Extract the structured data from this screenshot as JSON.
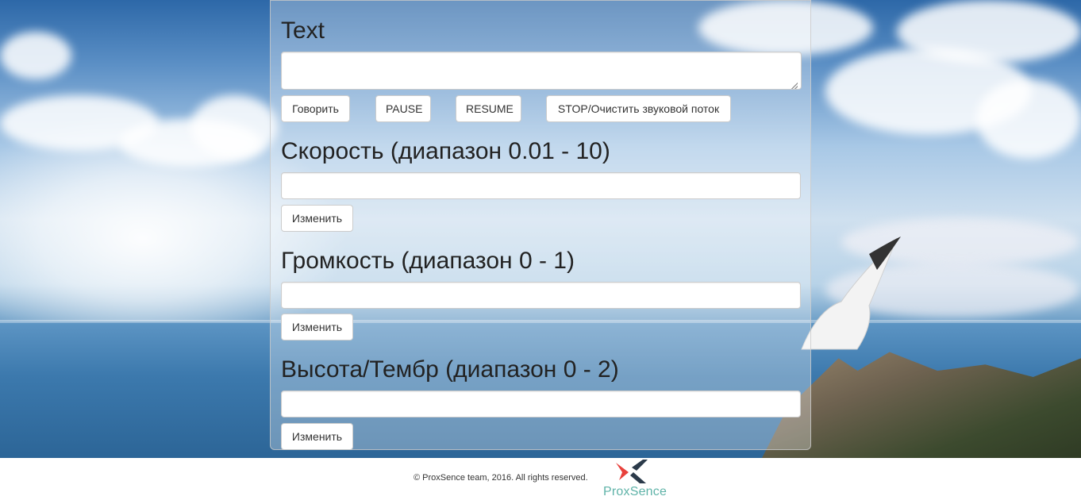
{
  "text_section": {
    "heading": "Text",
    "textarea_value": "",
    "buttons": {
      "speak": "Говорить",
      "pause": "PAUSE",
      "resume": "RESUME",
      "stop": "STOP/Очистить звуковой поток"
    }
  },
  "rate_section": {
    "heading": "Скорость (диапазон 0.01 - 10)",
    "input_value": "",
    "button": "Изменить"
  },
  "volume_section": {
    "heading": "Громкость (диапазон 0 - 1)",
    "input_value": "",
    "button": "Изменить"
  },
  "pitch_section": {
    "heading": "Высота/Тембр (диапазон 0 - 2)",
    "input_value": "",
    "button": "Изменить"
  },
  "footer": {
    "copyright": "© ProxSence team, 2016. All rights reserved.",
    "logo_text": "ProxSence"
  },
  "colors": {
    "logo_red": "#e8413c",
    "logo_dark": "#2b3a4a",
    "logo_teal": "#5fb3a8"
  }
}
